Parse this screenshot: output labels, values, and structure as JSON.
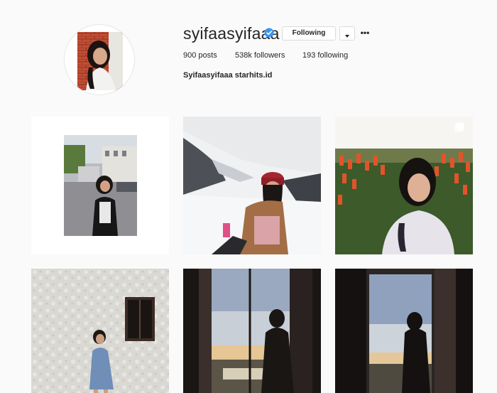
{
  "profile": {
    "username": "syifaasyifaaa",
    "verified": true,
    "follow_button_label": "Following",
    "more_label": "•••",
    "stats": {
      "posts_count": "900",
      "posts_label": "posts",
      "followers_count": "538k",
      "followers_label": "followers",
      "following_count": "193",
      "following_label": "following"
    },
    "bio_name": "Syifaasyifaaa",
    "bio_link": "starhits.id"
  },
  "posts": [
    {
      "name": "street-photo",
      "type": "image"
    },
    {
      "name": "snow-selfie",
      "type": "image"
    },
    {
      "name": "flower-field-selfie",
      "type": "image",
      "multiple": true
    },
    {
      "name": "wall-pose",
      "type": "image"
    },
    {
      "name": "window-silhouette-1",
      "type": "image"
    },
    {
      "name": "window-silhouette-2",
      "type": "image"
    }
  ],
  "colors": {
    "background": "#fafafa",
    "text": "#262626",
    "verified_blue": "#3897f0",
    "border": "#dbdbdb"
  }
}
